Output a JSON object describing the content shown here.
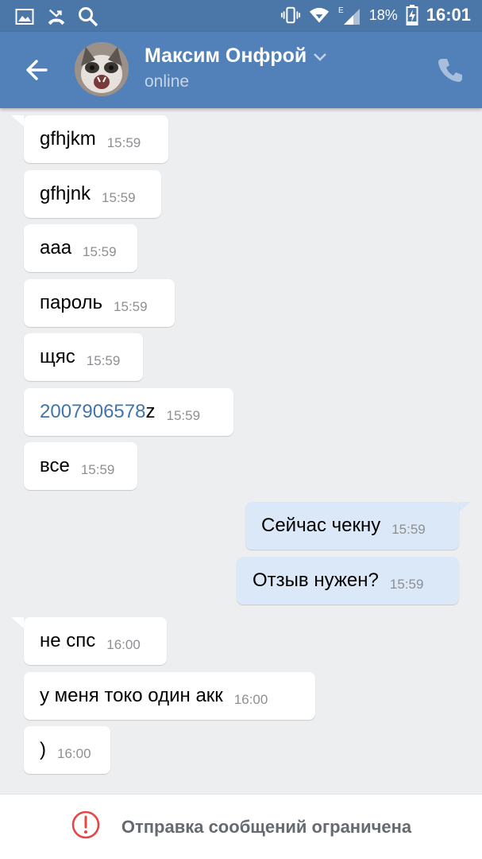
{
  "status_bar": {
    "time": "16:01",
    "battery_percent": "18%",
    "network_type": "E",
    "icons": [
      "gallery-icon",
      "missed-call-icon",
      "search-icon",
      "vibrate-icon",
      "wifi-icon",
      "signal-icon",
      "battery-charging-icon"
    ]
  },
  "header": {
    "name": "Максим Онфрой",
    "status": "online",
    "icons": [
      "back-arrow-icon",
      "chevron-down-icon",
      "phone-icon"
    ]
  },
  "messages": [
    {
      "dir": "in",
      "text": "gfhjkm",
      "time": "15:59"
    },
    {
      "dir": "in",
      "text": "gfhjnk",
      "time": "15:59"
    },
    {
      "dir": "in",
      "text": "ааа",
      "time": "15:59"
    },
    {
      "dir": "in",
      "text": "пароль",
      "time": "15:59"
    },
    {
      "dir": "in",
      "text": "щяс",
      "time": "15:59"
    },
    {
      "dir": "in",
      "link": "2007906578",
      "text": "z",
      "time": "15:59"
    },
    {
      "dir": "in",
      "text": "все",
      "time": "15:59"
    },
    {
      "dir": "out",
      "text": "Сейчас чекну",
      "time": "15:59"
    },
    {
      "dir": "out",
      "text": "Отзыв нужен?",
      "time": "15:59"
    },
    {
      "dir": "in",
      "text": "не спс",
      "time": "16:00"
    },
    {
      "dir": "in",
      "text": "у меня токо один акк",
      "time": "16:00"
    },
    {
      "dir": "in",
      "text": ")",
      "time": "16:00"
    }
  ],
  "footer": {
    "notice": "Отправка сообщений ограничена",
    "icon": "alert-circle-icon",
    "accent_color": "#e64646"
  },
  "colors": {
    "status_bar": "#4a76a8",
    "app_bar": "#5181b8",
    "background": "#edeef0",
    "incoming_bubble": "#ffffff",
    "outgoing_bubble": "#dbe8f7",
    "link": "#3f75ad"
  }
}
